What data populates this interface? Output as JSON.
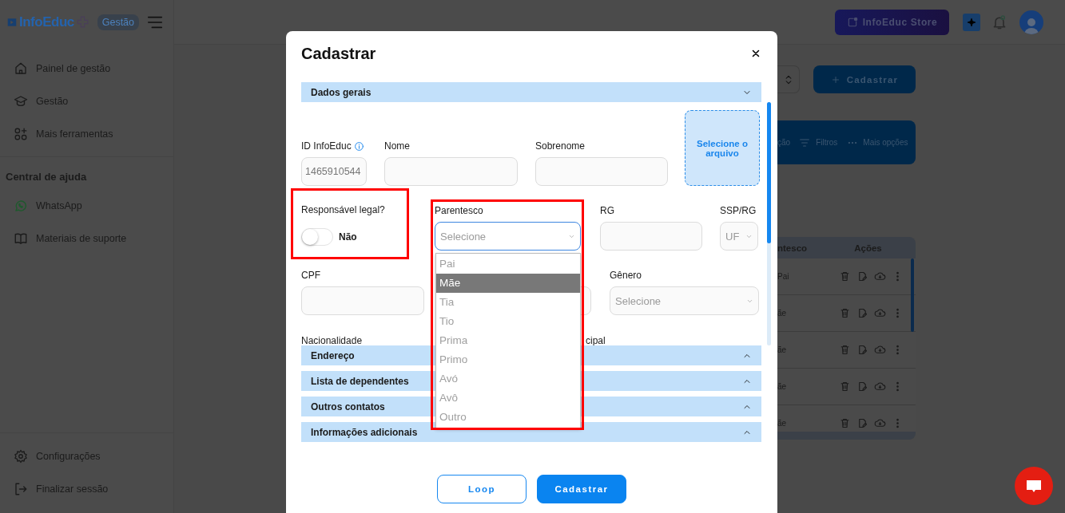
{
  "sidebar": {
    "logo": "InfoEduc",
    "badge": "Gestão",
    "nav": [
      "Painel de gestão",
      "Gestão",
      "Mais ferramentas"
    ],
    "help_title": "Central de ajuda",
    "help_items": [
      "WhatsApp",
      "Materiais de suporte"
    ],
    "footer_items": [
      "Configurações",
      "Finalizar sessão"
    ]
  },
  "header": {
    "store_button": "InfoEduc Store"
  },
  "page": {
    "register_button": "Cadastrar",
    "toolbar": [
      "ção",
      "Filtros",
      "Mais opções"
    ],
    "table": {
      "columns": [
        "ntesco",
        "Ações"
      ],
      "rows": [
        "Pai",
        "ãe",
        "ãe",
        "ãe",
        "ãe"
      ]
    }
  },
  "modal": {
    "title": "Cadastrar",
    "general_section": {
      "title": "Dados gerais",
      "expanded": true
    },
    "id_field": {
      "label": "ID InfoEduc",
      "value": "1465910544"
    },
    "name_field": {
      "label": "Nome"
    },
    "surname_field": {
      "label": "Sobrenome"
    },
    "upload": "Selecione o arquivo",
    "legal_guardian": {
      "label": "Responsável legal?",
      "on": false,
      "state_text": "Não"
    },
    "kinship": {
      "label": "Parentesco",
      "placeholder": "Selecione",
      "options": [
        {
          "label": "Pai",
          "selected": false
        },
        {
          "label": "Mãe",
          "selected": true
        },
        {
          "label": "Tia",
          "selected": false
        },
        {
          "label": "Tio",
          "selected": false
        },
        {
          "label": "Prima",
          "selected": false
        },
        {
          "label": "Primo",
          "selected": false
        },
        {
          "label": "Avó",
          "selected": false
        },
        {
          "label": "Avô",
          "selected": false
        },
        {
          "label": "Outro",
          "selected": false
        }
      ]
    },
    "rg_field": {
      "label": "RG"
    },
    "issuer_select": {
      "label": "SSP/RG",
      "placeholder": "UF"
    },
    "cpf_field": {
      "label": "CPF"
    },
    "gender_select": {
      "label": "Gênero",
      "placeholder": "Selecione"
    },
    "nationality_label": "Nacionalidade",
    "cut_label": "cipal",
    "sections": [
      {
        "title": "Endereço",
        "expanded": false
      },
      {
        "title": "Lista de dependentes",
        "expanded": false
      },
      {
        "title": "Outros contatos",
        "expanded": false
      },
      {
        "title": "Informações adicionais",
        "expanded": false
      }
    ],
    "buttons": [
      {
        "label": "Loop",
        "kind": "secondary"
      },
      {
        "label": "Cadastrar",
        "kind": "primary"
      }
    ]
  }
}
